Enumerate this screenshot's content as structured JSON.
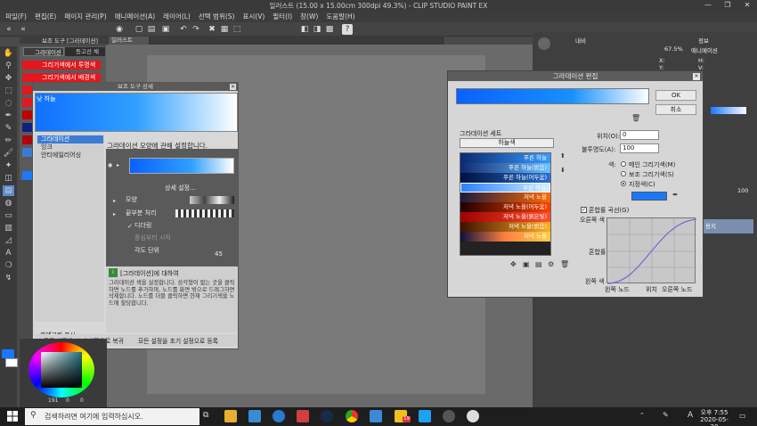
{
  "window": {
    "title": "일러스트 (15.00 x 15.00cm 300dpi 49.3%) - CLIP STUDIO PAINT EX"
  },
  "menu": [
    "파일(F)",
    "편집(E)",
    "페이지 관리(P)",
    "애니메이션(A)",
    "레이어(L)",
    "선택 범위(S)",
    "표시(V)",
    "필터(I)",
    "창(W)",
    "도움말(H)"
  ],
  "subtool_panel": {
    "tabs": [
      "그라데이션",
      "등고선 채"
    ],
    "items": [
      "그리기색에서 투명색",
      "그리기색에서 배경색"
    ],
    "nav_label": "보조 도구 [그라데이션]"
  },
  "canvas_tab": "일러스트",
  "right_panel": {
    "tabs": [
      "내비",
      "정보"
    ],
    "zoom_text": "67.5%",
    "rotate_text": "애니메이션",
    "readouts": [
      "X:",
      "Y:",
      "H:",
      "V:"
    ],
    "value_100": "100",
    "layer_name": "용지"
  },
  "detail_window": {
    "title": "보조 도구 상세",
    "preview_label": "낮 하늘",
    "categories": [
      "그라데이션",
      "잉크",
      "안티에일리어싱"
    ],
    "description": "그라데이션 모양에 관해 설정합니다.",
    "detail_settings": "상세 설정...",
    "props": {
      "shape": "모양",
      "edge": "끝부분 처리",
      "dither": "디더링",
      "reference": "중심부터 시작",
      "angle": "각도 단위",
      "angle_value": "45"
    },
    "help_title": "[그라데이션]에 대하여",
    "help_body": "그라데이션 색을 설정합니다. 삼각형이 없는 곳을 클릭하면 노드를 추가하며, 노드를 화면 밖으로 드래그하면 삭제합니다. 노드를 더블 클릭하면 현재 그리기색을 노드에 할당합니다.",
    "category_display": "카테고리 표시",
    "reset_buttons": [
      "모든 설정을 초기 설정으로 복귀",
      "모든 설정을 초기 설정으로 등록"
    ]
  },
  "gradient_dialog": {
    "title": "그라데이션 편집",
    "ok": "OK",
    "cancel": "취소",
    "set_label": "그라데이션 세트",
    "set_selected": "하늘색",
    "sets": [
      "푸른 하늘",
      "푸른 하늘(밝음)",
      "푸른 하늘(어두움)",
      "푸른 하늘",
      "저녁 노을",
      "저녁 노을(어두움)",
      "저녁 노을(붉은빛)",
      "저녁 노을(밝음)",
      "저녁 노을"
    ],
    "position_label": "위치(O):",
    "position_value": "0",
    "opacity_label": "불투명도(A):",
    "opacity_value": "100",
    "color_label": "색:",
    "color_options": [
      "메인 그리기색(M)",
      "보조 그리기색(S)",
      "지정색(C)"
    ],
    "curve_label": "혼합률 곡선(G)",
    "curve_axis": {
      "right_color": "오른쪽 색",
      "mix": "혼합률",
      "left_color": "왼쪽 색",
      "left_node": "왼쪽 노드",
      "position": "위치",
      "right_node": "오른쪽 노드"
    },
    "swatch_color": "#1a78ff"
  },
  "color_panel": {
    "values": [
      "191",
      "0",
      "0"
    ]
  },
  "taskbar": {
    "search_placeholder": "검색하려면 여기에 입력하십시오.",
    "time": "오후 7:55",
    "date": "2020-05-30",
    "ime": "A",
    "badge": "19"
  }
}
